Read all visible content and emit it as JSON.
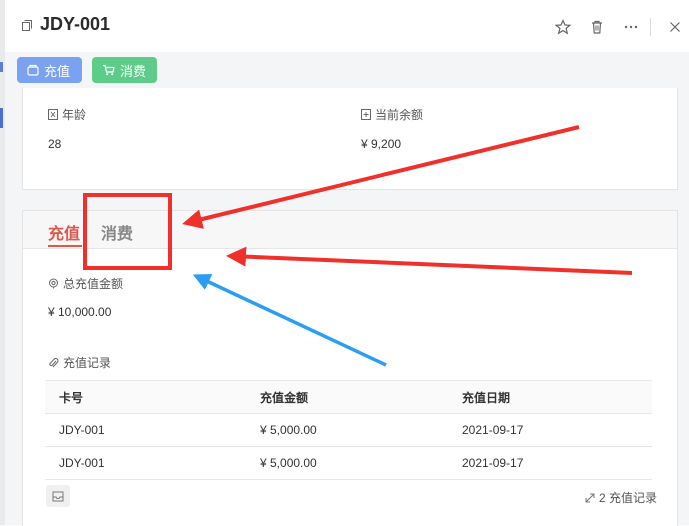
{
  "header": {
    "title": "JDY-001",
    "icons": [
      "copy-icon",
      "star-icon",
      "trash-icon",
      "more-icon",
      "close-icon"
    ]
  },
  "toolbar": {
    "recharge_label": "充值",
    "consume_label": "消费"
  },
  "info": {
    "age_label": "年龄",
    "age_value": "28",
    "balance_label": "当前余额",
    "balance_value": "¥ 9,200"
  },
  "tabs": [
    {
      "label": "充值",
      "active": true
    },
    {
      "label": "消费",
      "active": false
    }
  ],
  "summary": {
    "total_label": "总充值金额",
    "total_value": "¥ 10,000.00",
    "records_label": "充值记录"
  },
  "table": {
    "columns": [
      "卡号",
      "充值金额",
      "充值日期"
    ],
    "rows": [
      [
        "JDY-001",
        "¥ 5,000.00",
        "2021-09-17"
      ],
      [
        "JDY-001",
        "¥ 5,000.00",
        "2021-09-17"
      ]
    ]
  },
  "footer": {
    "count_text": "2 充值记录"
  },
  "annotation_colors": {
    "red": "#f0302a",
    "blue": "#2a9df4"
  }
}
